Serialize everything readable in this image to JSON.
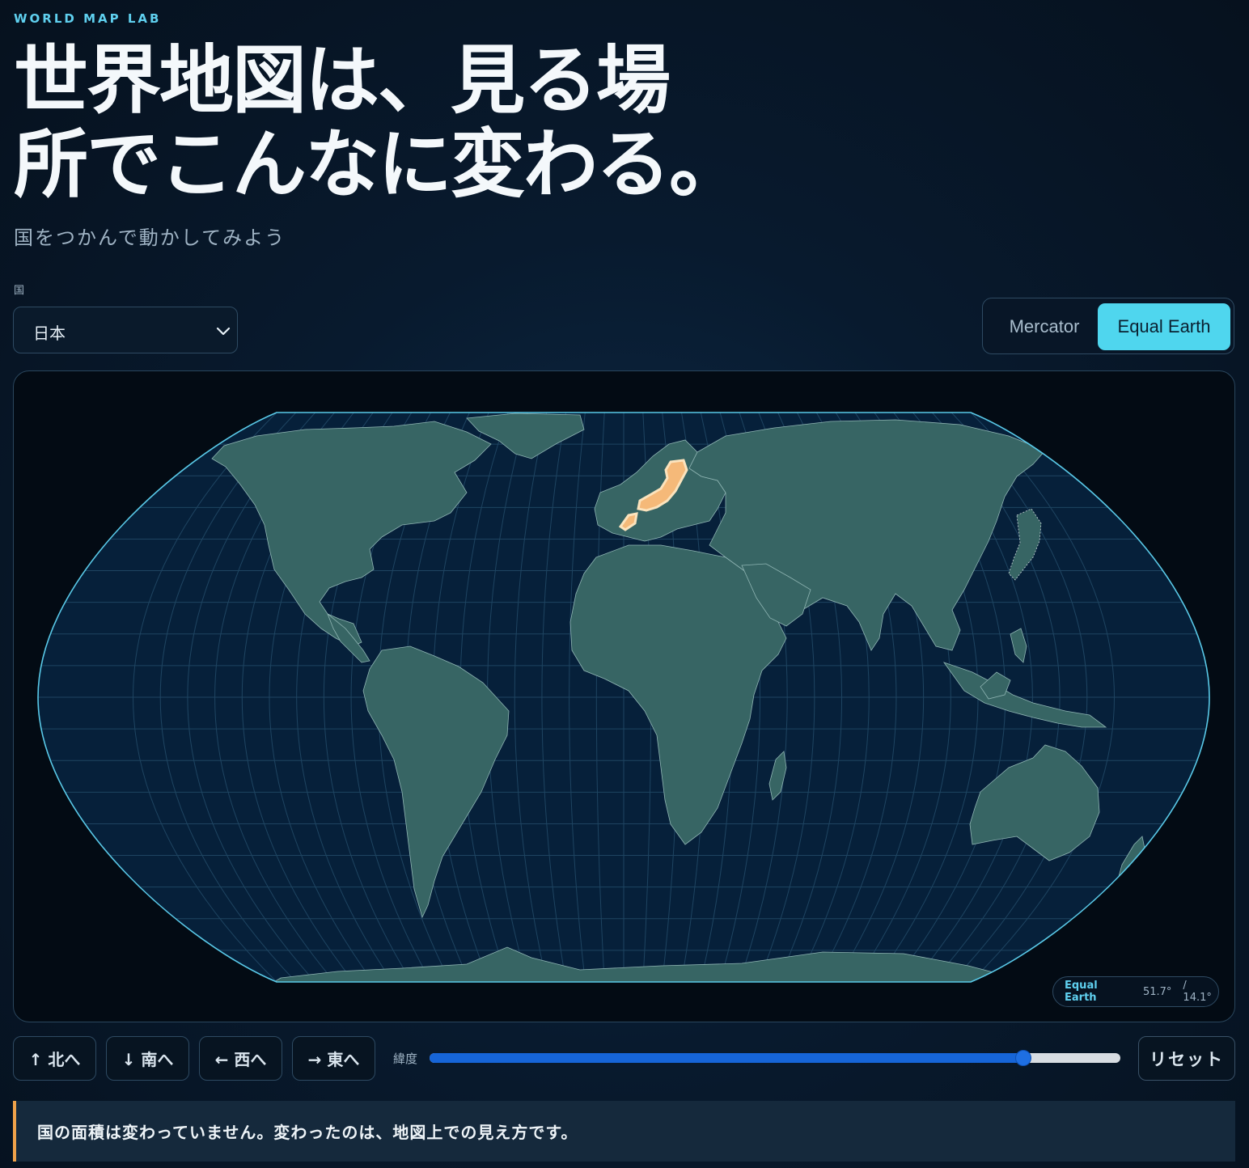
{
  "header": {
    "eyebrow": "WORLD MAP LAB",
    "title_line1": "世界地図は、見る場",
    "title_line2": "所でこんなに変わる。",
    "subtitle": "国をつかんで動かしてみよう"
  },
  "country_select": {
    "label": "国",
    "value": "日本"
  },
  "projection_toggle": {
    "options": [
      "Mercator",
      "Equal Earth"
    ],
    "selected": "Equal Earth"
  },
  "map": {
    "projection": "Equal Earth",
    "highlighted_country": "日本",
    "badge": {
      "projection": "Equal Earth",
      "lat": "51.7°",
      "lon": "/ 14.1°"
    },
    "colors": {
      "ocean": "#06203a",
      "land": "#376564",
      "borders": "#8fb5b3",
      "graticule": "#1e4461",
      "outline": "#59c9e8",
      "highlight": "#f7d9a8"
    }
  },
  "controls": {
    "north": "↑ 北へ",
    "south": "↓ 南へ",
    "west": "← 西へ",
    "east": "→ 東へ",
    "latitude_label": "緯度",
    "latitude_slider_fraction": 0.86,
    "reset": "リセット"
  },
  "note": "国の面積は変わっていません。変わったのは、地図上での見え方です。",
  "accent_color": "#4fd6ee"
}
